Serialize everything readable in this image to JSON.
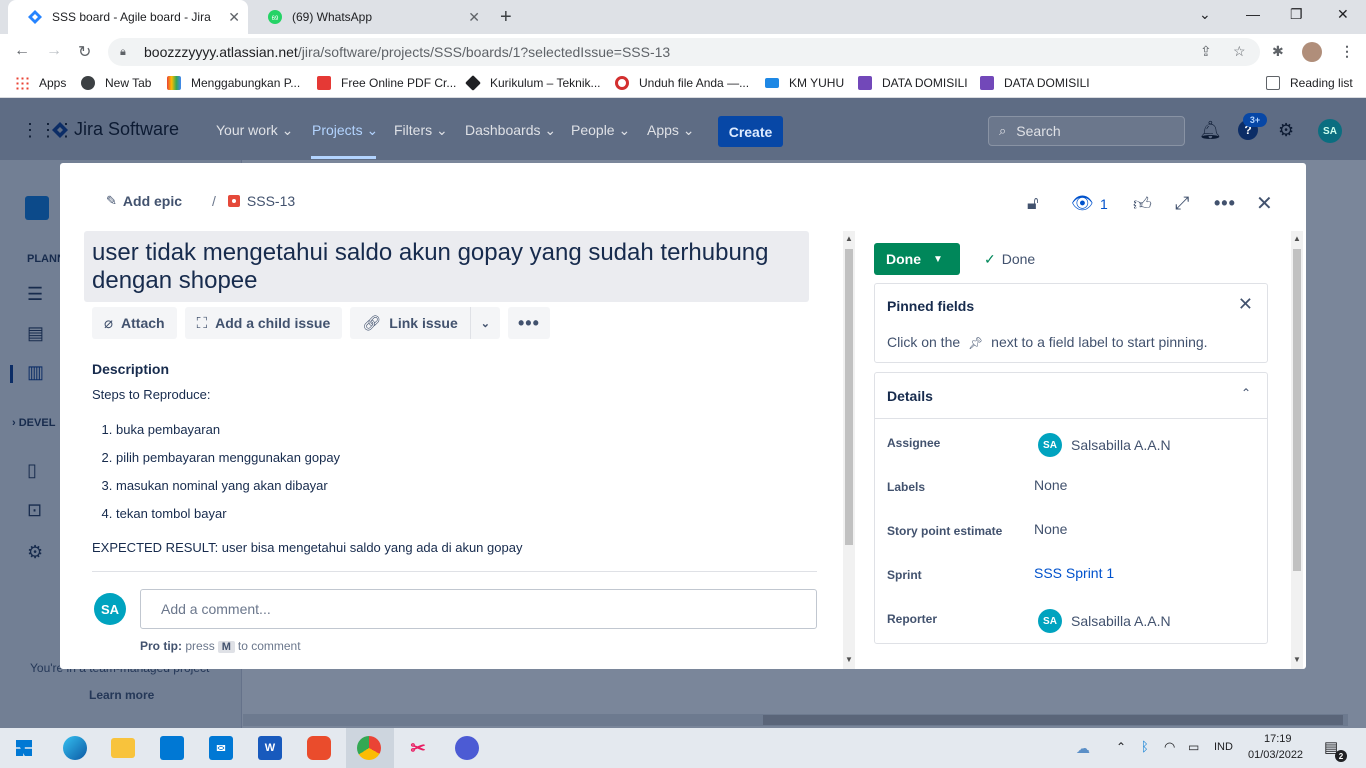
{
  "browser": {
    "tabs": [
      {
        "title": "SSS board - Agile board - Jira",
        "active": true
      },
      {
        "title": "(69) WhatsApp",
        "badge": "69",
        "active": false
      }
    ],
    "url_host": "boozzzyyyy.atlassian.net",
    "url_path": "/jira/software/projects/SSS/boards/1?selectedIssue=SSS-13",
    "bookmarks": [
      "Apps",
      "New Tab",
      "Menggabungkan P...",
      "Free Online PDF Cr...",
      "Kurikulum – Teknik...",
      "Unduh file Anda —...",
      "KM YUHU",
      "DATA DOMISILI",
      "DATA DOMISILI"
    ],
    "reading_list": "Reading list"
  },
  "jira": {
    "logo": "Jira Software",
    "nav": [
      "Your work",
      "Projects",
      "Filters",
      "Dashboards",
      "People",
      "Apps"
    ],
    "create": "Create",
    "search_placeholder": "Search",
    "notif_badge": "3+",
    "user_initials": "SA",
    "sidebar": {
      "planning": "PLANN",
      "development": "DEVEL",
      "team_note": "You're in a team-managed project",
      "learn_more": "Learn more"
    }
  },
  "issue": {
    "add_epic": "Add epic",
    "key": "SSS-13",
    "watchers": "1",
    "summary": "user tidak mengetahui saldo akun gopay yang sudah terhubung dengan shopee",
    "actions": {
      "attach": "Attach",
      "add_child": "Add a child issue",
      "link_issue": "Link issue"
    },
    "description_label": "Description",
    "description": {
      "intro": "Steps to Reproduce:",
      "steps": [
        "buka pembayaran",
        "pilih pembayaran menggunakan gopay",
        "masukan nominal yang akan dibayar",
        "tekan tombol bayar"
      ],
      "expected": "EXPECTED RESULT: user bisa mengetahui saldo yang ada di akun gopay"
    },
    "comment": {
      "avatar": "SA",
      "placeholder": "Add a comment...",
      "protip_label": "Pro tip:",
      "protip_pre": "press",
      "protip_key": "M",
      "protip_post": "to comment"
    },
    "status": "Done",
    "resolution": "Done",
    "pinned": {
      "title": "Pinned fields",
      "hint_pre": "Click on the",
      "hint_post": "next to a field label to start pinning."
    },
    "details": {
      "title": "Details",
      "assignee_label": "Assignee",
      "assignee": "Salsabilla A.A.N",
      "assignee_initials": "SA",
      "labels_label": "Labels",
      "labels": "None",
      "story_points_label": "Story point estimate",
      "story_points": "None",
      "sprint_label": "Sprint",
      "sprint": "SSS Sprint 1",
      "reporter_label": "Reporter",
      "reporter": "Salsabilla A.A.N",
      "reporter_initials": "SA"
    }
  },
  "taskbar": {
    "time": "17:19",
    "date": "01/03/2022",
    "lang": "IND",
    "notif_count": "2"
  },
  "colors": {
    "jira_blue": "#0052cc",
    "done_green": "#00875a",
    "avatar_teal": "#00a3bf"
  }
}
